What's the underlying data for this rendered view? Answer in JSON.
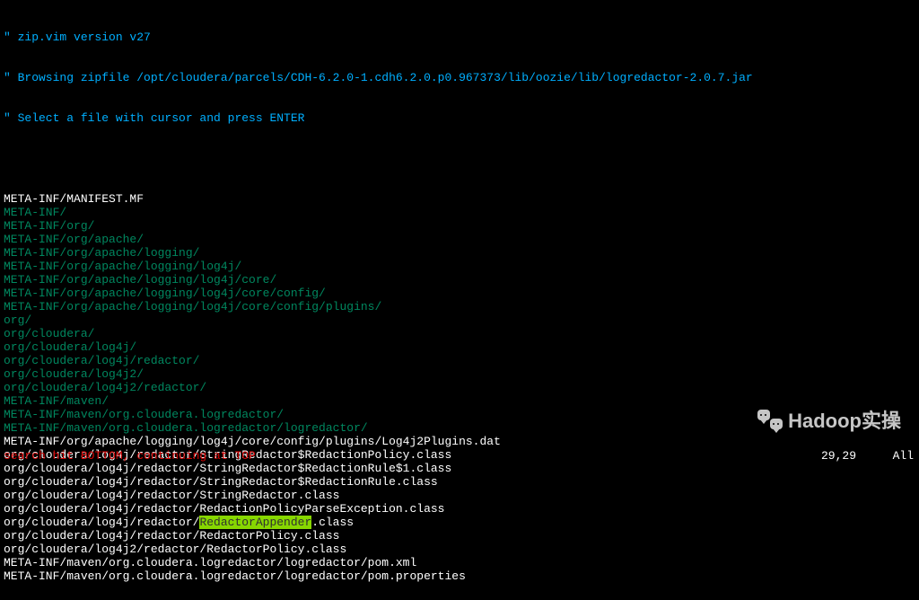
{
  "header": {
    "line1": "\" zip.vim version v27",
    "line2": "\" Browsing zipfile /opt/cloudera/parcels/CDH-6.2.0-1.cdh6.2.0.p0.967373/lib/oozie/lib/logredactor-2.0.7.jar",
    "line3": "\" Select a file with cursor and press ENTER"
  },
  "entries": [
    {
      "text": "META-INF/MANIFEST.MF",
      "type": "file"
    },
    {
      "text": "META-INF/",
      "type": "dir"
    },
    {
      "text": "META-INF/org/",
      "type": "dir"
    },
    {
      "text": "META-INF/org/apache/",
      "type": "dir"
    },
    {
      "text": "META-INF/org/apache/logging/",
      "type": "dir"
    },
    {
      "text": "META-INF/org/apache/logging/log4j/",
      "type": "dir"
    },
    {
      "text": "META-INF/org/apache/logging/log4j/core/",
      "type": "dir"
    },
    {
      "text": "META-INF/org/apache/logging/log4j/core/config/",
      "type": "dir"
    },
    {
      "text": "META-INF/org/apache/logging/log4j/core/config/plugins/",
      "type": "dir"
    },
    {
      "text": "org/",
      "type": "dir"
    },
    {
      "text": "org/cloudera/",
      "type": "dir"
    },
    {
      "text": "org/cloudera/log4j/",
      "type": "dir"
    },
    {
      "text": "org/cloudera/log4j/redactor/",
      "type": "dir"
    },
    {
      "text": "org/cloudera/log4j2/",
      "type": "dir"
    },
    {
      "text": "org/cloudera/log4j2/redactor/",
      "type": "dir"
    },
    {
      "text": "META-INF/maven/",
      "type": "dir"
    },
    {
      "text": "META-INF/maven/org.cloudera.logredactor/",
      "type": "dir"
    },
    {
      "text": "META-INF/maven/org.cloudera.logredactor/logredactor/",
      "type": "dir"
    },
    {
      "text": "META-INF/org/apache/logging/log4j/core/config/plugins/Log4j2Plugins.dat",
      "type": "file"
    },
    {
      "text": "org/cloudera/log4j/redactor/StringRedactor$RedactionPolicy.class",
      "type": "file"
    },
    {
      "text": "org/cloudera/log4j/redactor/StringRedactor$RedactionRule$1.class",
      "type": "file"
    },
    {
      "text": "org/cloudera/log4j/redactor/StringRedactor$RedactionRule.class",
      "type": "file"
    },
    {
      "text": "org/cloudera/log4j/redactor/StringRedactor.class",
      "type": "file"
    },
    {
      "text": "org/cloudera/log4j/redactor/RedactionPolicyParseException.class",
      "type": "file"
    },
    {
      "text": "org/cloudera/log4j/redactor/",
      "prefix": true,
      "match": "RedactorAppender",
      "suffix": ".class",
      "type": "match"
    },
    {
      "text": "org/cloudera/log4j/redactor/RedactorPolicy.class",
      "type": "file"
    },
    {
      "text": "org/cloudera/log4j2/redactor/RedactorPolicy.class",
      "type": "file"
    },
    {
      "text": "META-INF/maven/org.cloudera.logredactor/logredactor/pom.xml",
      "type": "file"
    },
    {
      "text": "META-INF/maven/org.cloudera.logredactor/logredactor/pom.properties",
      "type": "file"
    }
  ],
  "status": {
    "message": "search hit BOTTOM, continuing at TOP",
    "position": "29,29",
    "scroll": "All"
  },
  "watermark": {
    "text": "Hadoop实操"
  }
}
